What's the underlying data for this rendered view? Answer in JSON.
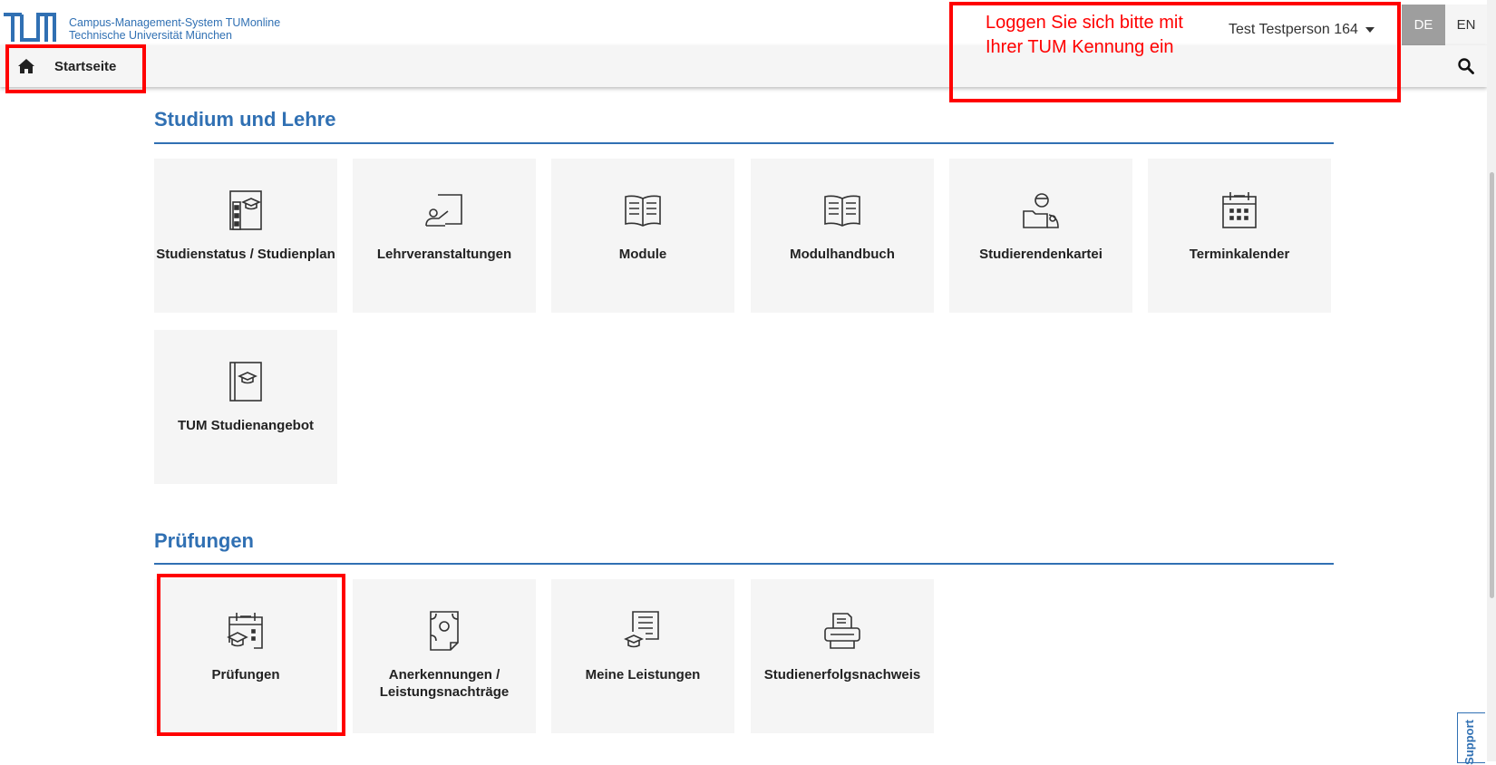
{
  "header": {
    "brand_line1": "Campus-Management-System TUMonline",
    "brand_line2": "Technische Universität München",
    "user_name": "Test Testperson 164",
    "lang_de": "DE",
    "lang_en": "EN"
  },
  "nav": {
    "home_label": "Startseite"
  },
  "annotation": {
    "login_hint": "Loggen Sie sich bitte mit Ihrer TUM Kennung ein"
  },
  "sections": [
    {
      "title": "Studium und Lehre",
      "tiles": [
        {
          "label": "Studienstatus / Studienplan",
          "icon": "study-status-icon"
        },
        {
          "label": "Lehrveranstaltungen",
          "icon": "lecture-icon"
        },
        {
          "label": "Module",
          "icon": "book-icon"
        },
        {
          "label": "Modulhandbuch",
          "icon": "book-icon"
        },
        {
          "label": "Studierendenkartei",
          "icon": "student-file-icon"
        },
        {
          "label": "Terminkalender",
          "icon": "calendar-icon"
        },
        {
          "label": "TUM Studienangebot",
          "icon": "study-offer-icon"
        }
      ]
    },
    {
      "title": "Prüfungen",
      "tiles": [
        {
          "label": "Prüfungen",
          "icon": "exam-calendar-icon"
        },
        {
          "label": "Anerkennungen / Leistungsnachträge",
          "icon": "certificate-icon"
        },
        {
          "label": "Meine Leistungen",
          "icon": "achievements-icon"
        },
        {
          "label": "Studienerfolgsnachweis",
          "icon": "printer-icon"
        }
      ]
    }
  ],
  "support": {
    "label": "Support"
  },
  "colors": {
    "accent": "#3070b3",
    "tile_bg": "#f5f5f5",
    "annotation": "#ff0000"
  }
}
